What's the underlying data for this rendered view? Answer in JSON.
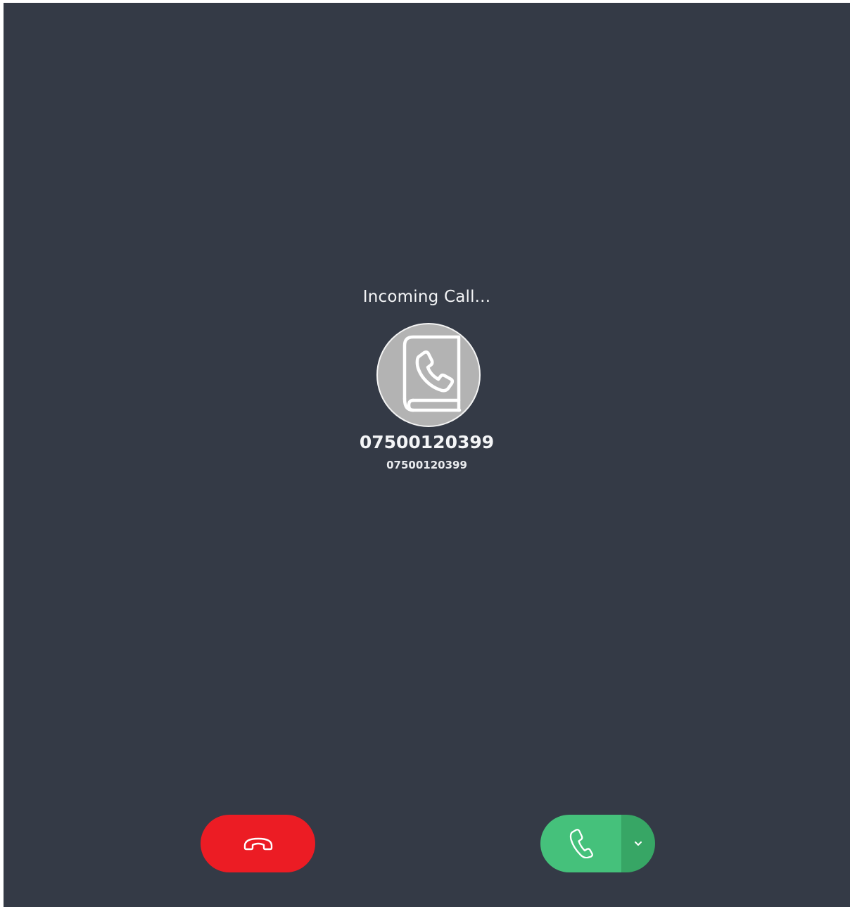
{
  "call": {
    "status": "Incoming Call...",
    "caller_name": "07500120399",
    "caller_number": "07500120399"
  },
  "avatar": {
    "icon": "phonebook-icon"
  },
  "actions": {
    "decline_icon": "hang-up-icon",
    "answer_icon": "phone-icon",
    "options_icon": "chevron-down-icon"
  },
  "colors": {
    "background": "#343a46",
    "decline": "#ec1c24",
    "answer": "#45c17b",
    "answer_options": "#37a665",
    "avatar_fill": "#b3b3b3"
  }
}
